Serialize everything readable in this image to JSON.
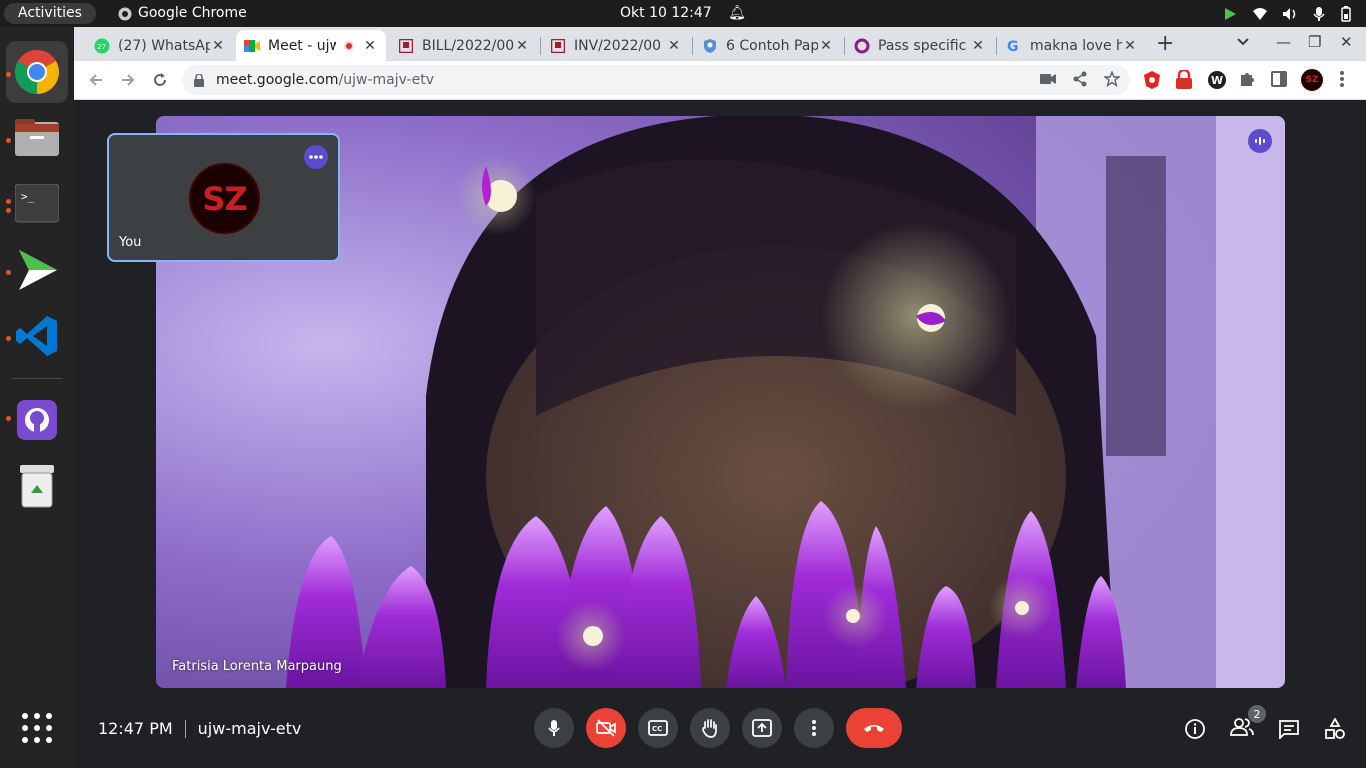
{
  "topbar": {
    "activities": "Activities",
    "app_name": "Google Chrome",
    "clock": "Okt 10  12:47"
  },
  "dock": {
    "items": [
      "chrome-icon",
      "files-icon",
      "terminal-icon",
      "play-icon",
      "vscode-icon",
      "github-icon",
      "trash-icon"
    ]
  },
  "tabs": [
    {
      "title": "(27) WhatsApp",
      "icon": "whatsapp-icon"
    },
    {
      "title": "Meet - ujw-majv-etv",
      "icon": "meet-icon"
    },
    {
      "title": "BILL/2022/00",
      "icon": "doc-icon"
    },
    {
      "title": "INV/2022/00",
      "icon": "doc-icon"
    },
    {
      "title": "6 Contoh Pap",
      "icon": "shield-icon"
    },
    {
      "title": "Pass specific",
      "icon": "circle-icon"
    },
    {
      "title": "makna love h",
      "icon": "google-icon"
    }
  ],
  "address": {
    "host": "meet.google.com",
    "path": "/ujw-majv-etv"
  },
  "meeting": {
    "participant_name": "Fatrisia Lorenta Marpaung",
    "self_label": "You",
    "self_initials": "SZ",
    "time": "12:47 PM",
    "code": "ujw-majv-etv",
    "participant_count": "2"
  },
  "colors": {
    "accent": "#5b4ccf",
    "danger": "#ea4335",
    "background": "#202124"
  }
}
